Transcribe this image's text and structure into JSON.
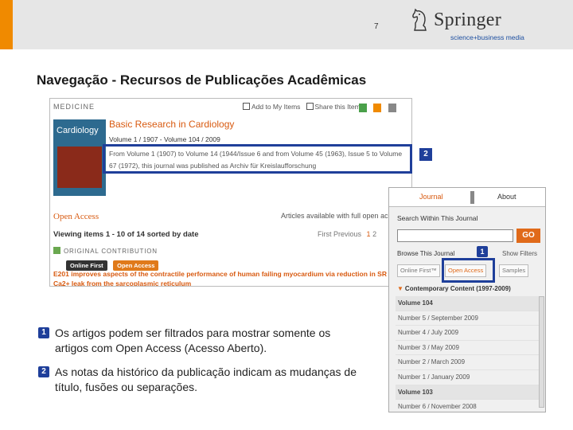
{
  "header": {
    "page_number": "7",
    "brand_name": "Springer",
    "brand_tagline": "science+business media",
    "accent_color": "#f08a00"
  },
  "slide_title": "Navegação - Recursos de Publicações Acadêmicas",
  "journal_page": {
    "category": "MEDICINE",
    "actions": [
      "Add to My Items",
      "Share this Item"
    ],
    "cover_title": "Cardiology",
    "journal_title": "Basic Research in Cardiology",
    "volume_info": "Volume 1 / 1907 - Volume 104 / 2009",
    "history_text": "From Volume 1 (1907) to Volume 14 (1944/Issue 6 and from Volume 45 (1963), Issue 5 to Volume 67 (1972), this journal was published as Archiv für Kreislaufforschung",
    "open_access_label": "Open Access",
    "articles_available": "Articles available with full open access",
    "viewing": "Viewing items 1 - 10 of 14 sorted by date",
    "pager": {
      "first": "First",
      "previous": "Previous",
      "current": "1",
      "next": "2"
    },
    "contribution_label": "ORIGINAL CONTRIBUTION",
    "badges": [
      "Online First",
      "Open Access"
    ],
    "article_title": "E201 improves aspects of the contractile performance of human failing myocardium via reduction in SR Ca2+ leak from the sarcoplasmic reticulum"
  },
  "sidebar_panel": {
    "tabs": [
      "Journal",
      "About"
    ],
    "search_label": "Search Within This Journal",
    "go_label": "GO",
    "browse_label": "Browse This Journal",
    "show_filters": "Show Filters",
    "filter_buttons": [
      "Online First™",
      "Open Access",
      "Samples"
    ],
    "contemporary": "Contemporary Content (1997-2009)",
    "rows": [
      {
        "text": "Volume 104",
        "type": "vol"
      },
      {
        "text": "Number 5 / September 2009",
        "type": "num"
      },
      {
        "text": "Number 4 / July 2009",
        "type": "num"
      },
      {
        "text": "Number 3 / May 2009",
        "type": "num"
      },
      {
        "text": "Number 2 / March 2009",
        "type": "num"
      },
      {
        "text": "Number 1 / January 2009",
        "type": "num"
      },
      {
        "text": "Volume 103",
        "type": "vol"
      },
      {
        "text": "Number 6 / November 2008",
        "type": "num"
      }
    ]
  },
  "callouts": {
    "one": "1",
    "two": "2",
    "highlight_color": "#1f3f9a"
  },
  "bullets": [
    {
      "num": "1",
      "text": "Os artigos podem ser filtrados para mostrar somente os artigos com Open Access (Acesso Aberto)."
    },
    {
      "num": "2",
      "text": "As notas da histórico da publicação indicam as mudanças de título, fusões ou separações."
    }
  ]
}
